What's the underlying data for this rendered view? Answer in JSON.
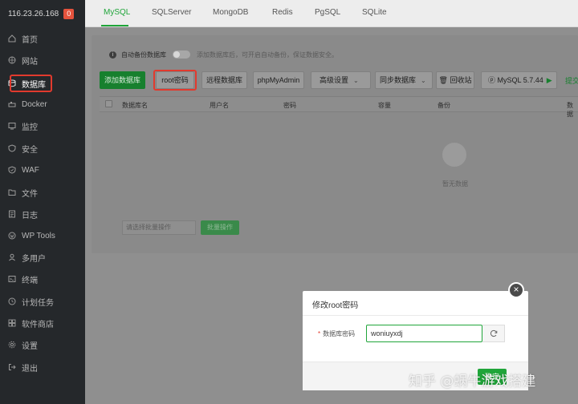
{
  "server": {
    "ip": "116.23.26.168",
    "badge": "0"
  },
  "sidebar": {
    "items": [
      {
        "label": "首页",
        "icon": "home-icon"
      },
      {
        "label": "网站",
        "icon": "globe-icon"
      },
      {
        "label": "数据库",
        "icon": "database-icon"
      },
      {
        "label": "Docker",
        "icon": "docker-icon"
      },
      {
        "label": "监控",
        "icon": "monitor-icon"
      },
      {
        "label": "安全",
        "icon": "shield-icon"
      },
      {
        "label": "WAF",
        "icon": "firewall-icon"
      },
      {
        "label": "文件",
        "icon": "folder-icon"
      },
      {
        "label": "日志",
        "icon": "log-icon"
      },
      {
        "label": "WP Tools",
        "icon": "wordpress-icon"
      },
      {
        "label": "多用户",
        "icon": "users-icon"
      },
      {
        "label": "终端",
        "icon": "terminal-icon"
      },
      {
        "label": "计划任务",
        "icon": "clock-icon"
      },
      {
        "label": "软件商店",
        "icon": "store-icon"
      },
      {
        "label": "设置",
        "icon": "gear-icon"
      },
      {
        "label": "退出",
        "icon": "logout-icon"
      }
    ]
  },
  "tabs": [
    "MySQL",
    "SQLServer",
    "MongoDB",
    "Redis",
    "PgSQL",
    "SQLite"
  ],
  "notice": {
    "label": "自动备份数据库",
    "desc": "添加数据库后，可开启自动备份，保证数据安全。"
  },
  "toolbar": {
    "add_db": "添加数据库",
    "root_password": "root密码",
    "remote_db": "远程数据库",
    "phpmyadmin": "phpMyAdmin",
    "advanced": "高级设置",
    "sync": "同步数据库",
    "recycle": "回收站",
    "version": "MySQL 5.7.44",
    "link": "提交"
  },
  "table": {
    "headers": [
      "数据库名",
      "用户名",
      "密码",
      "容量",
      "备份",
      "数据"
    ]
  },
  "empty_text": "暂无数据",
  "batch": {
    "placeholder": "请选择批量操作",
    "button": "批量操作"
  },
  "modal": {
    "title": "修改root密码",
    "field_label": "数据库密码",
    "field_value": "woniuyxdj",
    "confirm": "确定"
  },
  "watermark": "知乎 @蜗牛游戏搭建",
  "colors": {
    "accent": "#20a53a",
    "highlight": "#e23a2e",
    "sidebar": "#25282b"
  }
}
